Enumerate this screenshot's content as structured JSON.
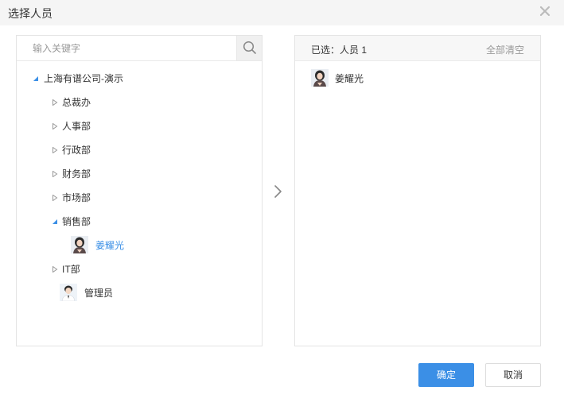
{
  "dialog": {
    "title": "选择人员",
    "close_icon": "close-icon"
  },
  "search": {
    "placeholder": "输入关键字",
    "value": ""
  },
  "tree": {
    "root": "上海有谱公司-演示",
    "departments": [
      {
        "label": "总裁办",
        "expanded": false
      },
      {
        "label": "人事部",
        "expanded": false
      },
      {
        "label": "行政部",
        "expanded": false
      },
      {
        "label": "财务部",
        "expanded": false
      },
      {
        "label": "市场部",
        "expanded": false
      },
      {
        "label": "销售部",
        "expanded": true
      },
      {
        "label": "IT部",
        "expanded": false
      }
    ],
    "sales_member": "姜耀光",
    "admin": "管理员"
  },
  "selected": {
    "header": "已选：人员 1",
    "clear_all": "全部清空",
    "items": [
      {
        "name": "姜耀光"
      }
    ]
  },
  "footer": {
    "ok_label": "确定",
    "cancel_label": "取消"
  },
  "colors": {
    "accent": "#3b8fe6",
    "selected_text": "#3b8fe6",
    "title_bar": "#f5f5f5",
    "border": "#e4e4e4"
  }
}
